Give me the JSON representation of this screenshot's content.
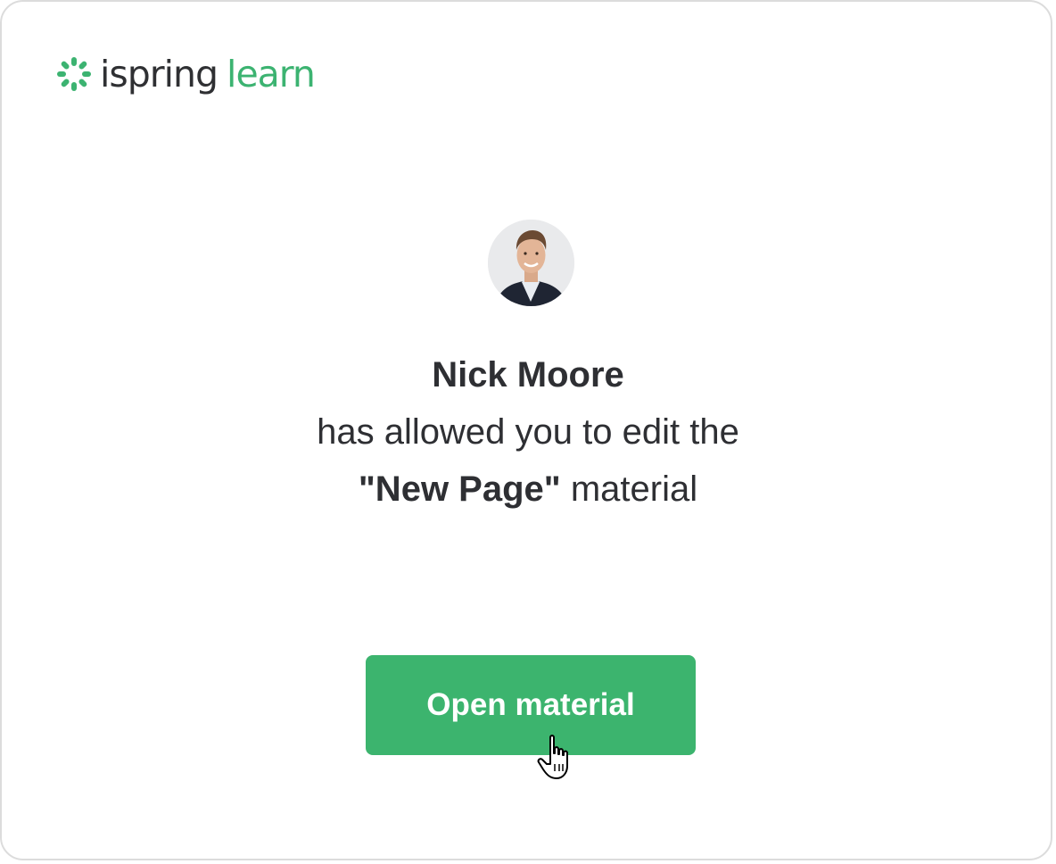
{
  "brand": {
    "name_part1": "ispring",
    "name_part2": "learn",
    "icon": "spark-icon",
    "accent_color": "#3cb371"
  },
  "notification": {
    "sender_name": "Nick Moore",
    "line2": "has allowed you to edit the",
    "material_name": "\"New Page\"",
    "material_suffix": " material"
  },
  "action": {
    "button_label": "Open material",
    "button_color": "#3cb46e"
  },
  "cursor": {
    "icon": "hand-pointer-icon"
  }
}
